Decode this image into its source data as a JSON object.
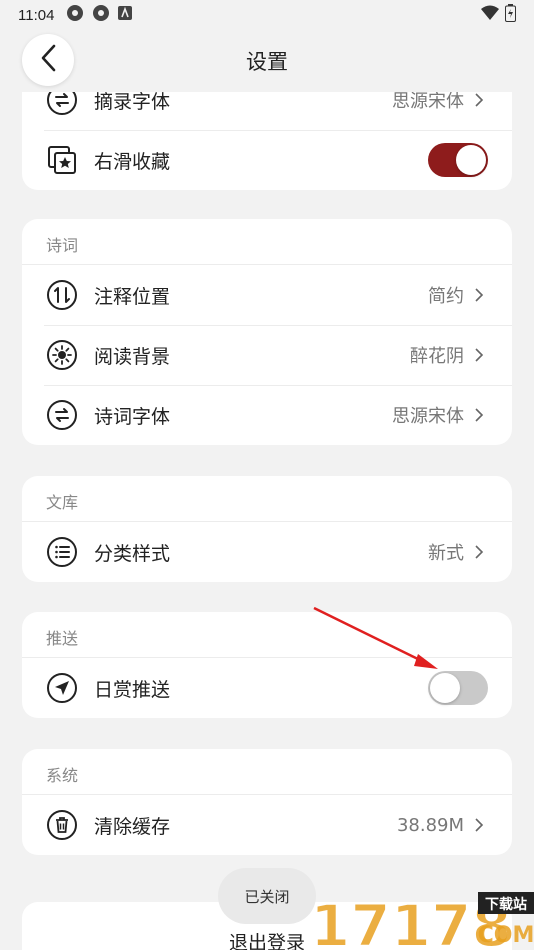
{
  "status_bar": {
    "time": "11:04"
  },
  "header": {
    "title": "设置"
  },
  "card_top": {
    "items": [
      {
        "label": "摘录字体",
        "value": "思源宋体"
      },
      {
        "label": "右滑收藏",
        "toggle": "on"
      }
    ]
  },
  "card_poetry": {
    "title": "诗词",
    "items": [
      {
        "label": "注释位置",
        "value": "简约"
      },
      {
        "label": "阅读背景",
        "value": "醉花阴"
      },
      {
        "label": "诗词字体",
        "value": "思源宋体"
      }
    ]
  },
  "card_library": {
    "title": "文库",
    "items": [
      {
        "label": "分类样式",
        "value": "新式"
      }
    ]
  },
  "card_push": {
    "title": "推送",
    "items": [
      {
        "label": "日赏推送",
        "toggle": "off"
      }
    ]
  },
  "card_system": {
    "title": "系统",
    "items": [
      {
        "label": "清除缓存",
        "value": "38.89M"
      }
    ]
  },
  "logout": {
    "label": "退出登录"
  },
  "toast": {
    "text": "已关闭"
  },
  "watermark": {
    "text": "17178",
    "badge": "下载站",
    "sub": "COM"
  },
  "colors": {
    "accent": "#8e1c1c",
    "annotation": "#e02020",
    "background": "#f2f2f2"
  },
  "icons": [
    "back-icon",
    "swap-icon",
    "collect-star-icon",
    "sort-icon",
    "sun-icon",
    "swap-icon",
    "list-icon",
    "send-icon",
    "trash-icon"
  ]
}
